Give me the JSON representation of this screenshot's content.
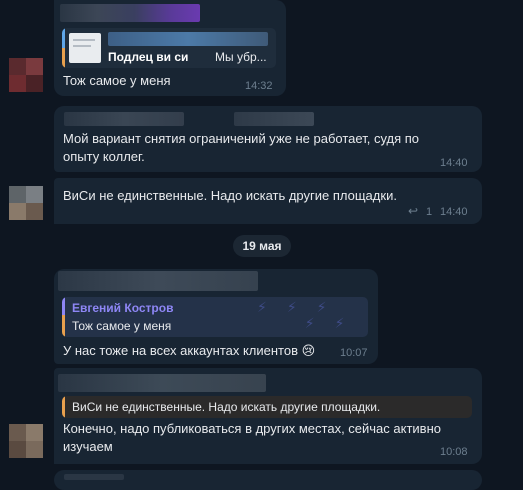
{
  "date_separator": "19 мая",
  "messages": [
    {
      "reply": {
        "author": "Подлец ви си",
        "snippet": "Мы убр..."
      },
      "text": "Тож самое у меня",
      "time": "14:32"
    },
    {
      "text": "Мой вариант снятия ограничений уже не работает, судя по\nопыту коллег.",
      "time": "14:40"
    },
    {
      "text": "ВиСи не единственные. Надо искать другие площадки.",
      "reply_count": "1",
      "time": "14:40"
    },
    {
      "reply": {
        "author": "Евгений Костров",
        "snippet": "Тож самое у меня"
      },
      "text": "У нас тоже на всех аккаунтах клиентов 😢",
      "time": "10:07"
    },
    {
      "reply": {
        "snippet": "ВиСи не единственные. Надо искать другие площадки."
      },
      "text": "Конечно, надо публиковаться в других местах, сейчас активно\nизучаем",
      "time": "10:08"
    }
  ],
  "colors": {
    "background": "#0e1621",
    "bubble": "#182533",
    "reply_accent": "#e8a04e",
    "reply_author": "#8e86f5",
    "reply_author_alt": "#ffffff"
  }
}
